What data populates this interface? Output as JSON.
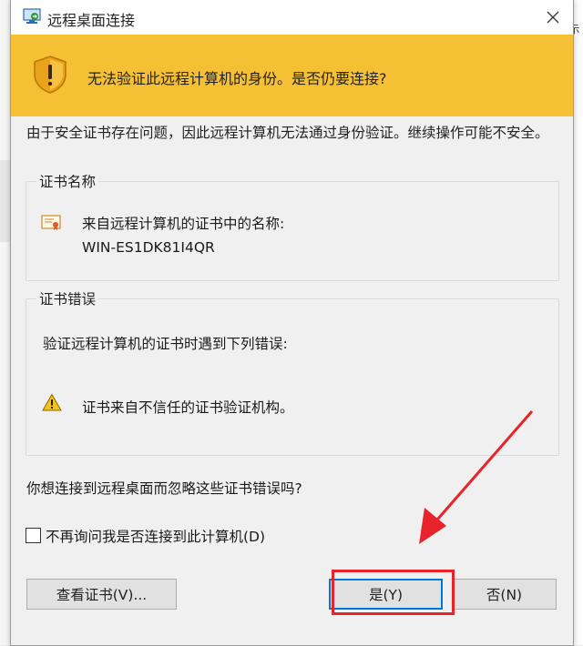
{
  "window": {
    "title": "远程桌面连接",
    "close_glyph": "✕"
  },
  "banner": {
    "message": "无法验证此远程计算机的身份。是否仍要连接?",
    "icon": "shield-warning-icon",
    "color": "#f5c033"
  },
  "intro": "由于安全证书存在问题，因此远程计算机无法通过身份验证。继续操作可能不安全。",
  "cert_name_group": {
    "label": "证书名称",
    "name_label": "来自远程计算机的证书中的名称:",
    "name_value": "WIN-ES1DK81I4QR",
    "icon": "certificate-icon"
  },
  "cert_error_group": {
    "label": "证书错误",
    "intro": "验证远程计算机的证书时遇到下列错误:",
    "error": "证书来自不信任的证书验证机构。",
    "icon": "warning-icon"
  },
  "question": "你想连接到远程桌面而忽略这些证书错误吗?",
  "dont_ask": {
    "label": "不再询问我是否连接到此计算机(D)",
    "checked": false
  },
  "buttons": {
    "view_cert": "查看证书(V)...",
    "yes": "是(Y)",
    "no": "否(N)"
  },
  "annotation": {
    "color": "#e8232a"
  },
  "background": {
    "side_text": "示"
  }
}
